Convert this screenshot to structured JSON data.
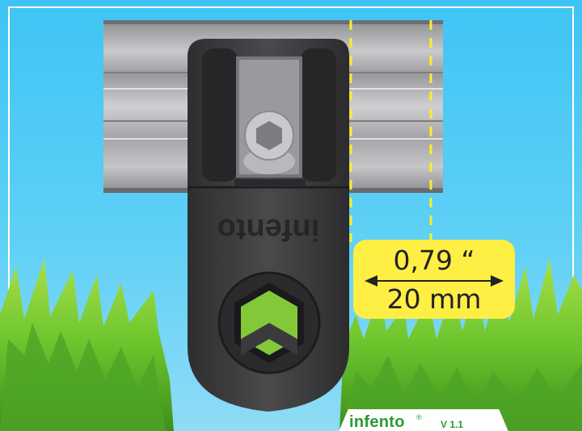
{
  "dimension": {
    "inch_label": "0,79 “",
    "mm_label": "20 mm"
  },
  "product_embossing": "infento",
  "branding": {
    "name": "infento",
    "registered": "®",
    "version": "V 1.1"
  },
  "colors": {
    "sky": "#3ec4f4",
    "label_yellow": "#ffee44",
    "guide_line": "#ffee22",
    "grass": "#6cc42c",
    "brand_green": "#2c9b33",
    "part_dark": "#3a3a3c",
    "profile_grey": "#a8a8ac"
  }
}
